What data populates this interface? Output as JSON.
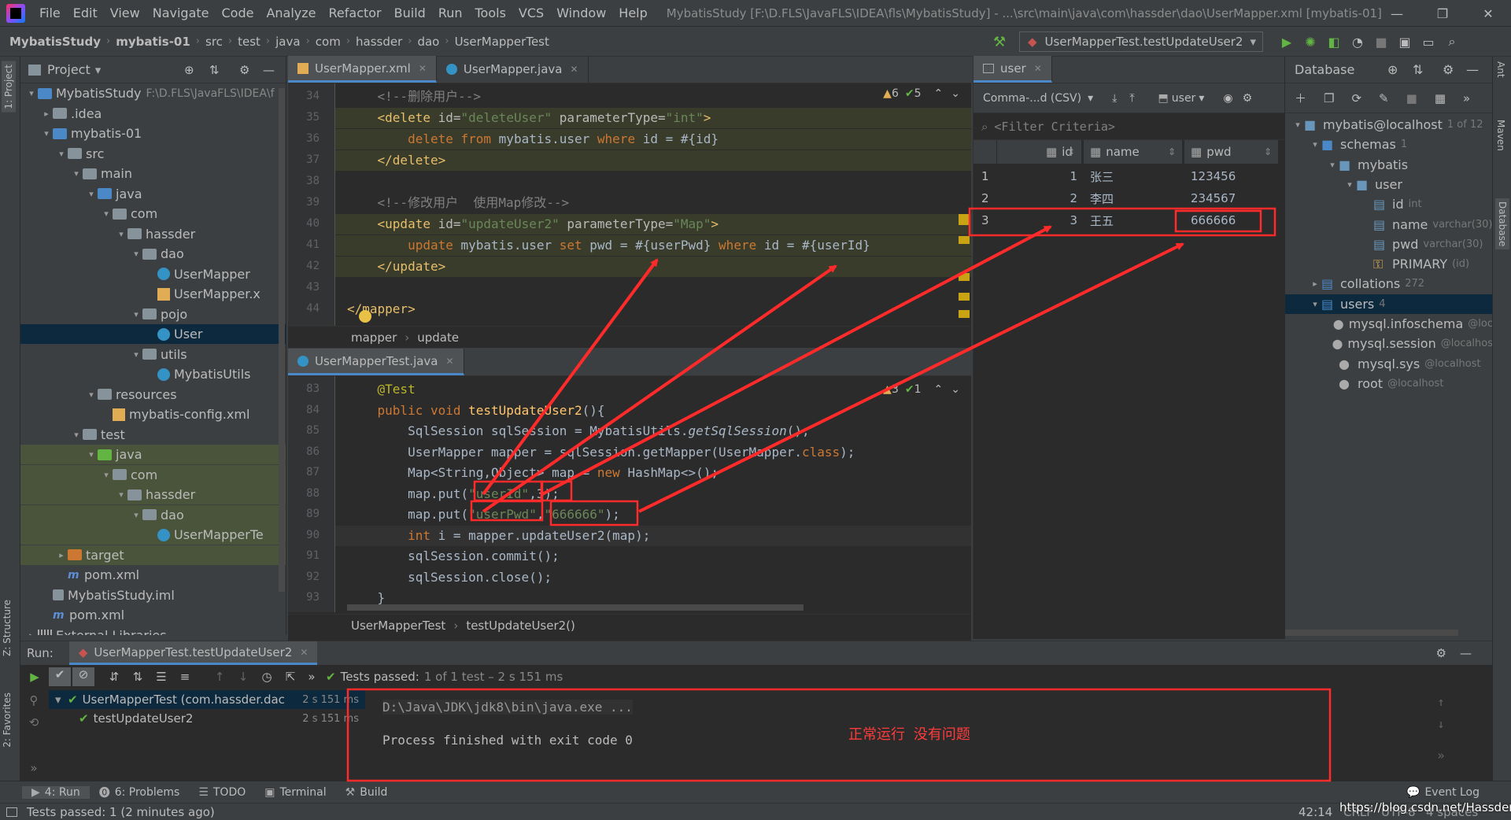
{
  "menu": {
    "items": [
      "File",
      "Edit",
      "View",
      "Navigate",
      "Code",
      "Analyze",
      "Refactor",
      "Build",
      "Run",
      "Tools",
      "VCS",
      "Window",
      "Help"
    ],
    "window_title": "MybatisStudy [F:\\D.FLS\\JavaFLS\\IDEA\\fls\\MybatisStudy] - ...\\src\\main\\java\\com\\hassder\\dao\\UserMapper.xml [mybatis-01]"
  },
  "navbar": {
    "crumbs": [
      "MybatisStudy",
      "mybatis-01",
      "src",
      "test",
      "java",
      "com",
      "hassder",
      "dao",
      "UserMapperTest"
    ],
    "run_config": "UserMapperTest.testUpdateUser2"
  },
  "left_strip": {
    "project_tab": "1: Project",
    "structure_tab": "Z: Structure",
    "favorites_tab": "2: Favorites"
  },
  "project": {
    "title": "Project",
    "tree": [
      {
        "label": "MybatisStudy",
        "extra": "F:\\D.FLS\\JavaFLS\\IDEA\\f",
        "indent": 0,
        "kind": "folder-blue",
        "open": true
      },
      {
        "label": ".idea",
        "indent": 1,
        "kind": "folder",
        "open": false
      },
      {
        "label": "mybatis-01",
        "indent": 1,
        "kind": "folder-blue",
        "open": true
      },
      {
        "label": "src",
        "indent": 2,
        "kind": "folder",
        "open": true
      },
      {
        "label": "main",
        "indent": 3,
        "kind": "folder",
        "open": true
      },
      {
        "label": "java",
        "indent": 4,
        "kind": "folder-blue",
        "open": true
      },
      {
        "label": "com",
        "indent": 5,
        "kind": "folder",
        "open": true
      },
      {
        "label": "hassder",
        "indent": 6,
        "kind": "folder",
        "open": true
      },
      {
        "label": "dao",
        "indent": 7,
        "kind": "folder",
        "open": true
      },
      {
        "label": "UserMapper",
        "indent": 8,
        "kind": "class"
      },
      {
        "label": "UserMapper.x",
        "indent": 8,
        "kind": "xml"
      },
      {
        "label": "pojo",
        "indent": 7,
        "kind": "folder",
        "open": true
      },
      {
        "label": "User",
        "indent": 8,
        "kind": "class",
        "selected": true
      },
      {
        "label": "utils",
        "indent": 7,
        "kind": "folder",
        "open": true
      },
      {
        "label": "MybatisUtils",
        "indent": 8,
        "kind": "class"
      },
      {
        "label": "resources",
        "indent": 4,
        "kind": "folder",
        "open": true
      },
      {
        "label": "mybatis-config.xml",
        "indent": 5,
        "kind": "xml"
      },
      {
        "label": "test",
        "indent": 3,
        "kind": "folder",
        "open": true
      },
      {
        "label": "java",
        "indent": 4,
        "kind": "folder-green",
        "open": true,
        "green": true
      },
      {
        "label": "com",
        "indent": 5,
        "kind": "folder",
        "open": true,
        "green": true
      },
      {
        "label": "hassder",
        "indent": 6,
        "kind": "folder",
        "open": true,
        "green": true
      },
      {
        "label": "dao",
        "indent": 7,
        "kind": "folder",
        "open": true,
        "green": true
      },
      {
        "label": "UserMapperTe",
        "indent": 8,
        "kind": "class",
        "green": true
      },
      {
        "label": "target",
        "indent": 2,
        "kind": "folder-orange",
        "open": false,
        "green": true
      },
      {
        "label": "pom.xml",
        "indent": 2,
        "kind": "maven"
      },
      {
        "label": "MybatisStudy.iml",
        "indent": 1,
        "kind": "iml"
      },
      {
        "label": "pom.xml",
        "indent": 1,
        "kind": "maven"
      },
      {
        "label": "External Libraries",
        "indent": 0,
        "kind": "lib",
        "open": false
      }
    ]
  },
  "editor_top": {
    "tabs": [
      {
        "label": "UserMapper.xml",
        "active": true
      },
      {
        "label": "UserMapper.java",
        "active": false
      }
    ],
    "status": {
      "warnings": "6",
      "ok": "5"
    },
    "lines": [
      {
        "no": "34",
        "html": "    <span class='cmt'>&lt;!--删除用户--&gt;</span>"
      },
      {
        "no": "35",
        "html": "    <span class='tag'>&lt;delete</span> <span class='attr'>id=</span><span class='str'>\"deleteUser\"</span> <span class='attr'>parameterType=</span><span class='str'>\"int\"</span><span class='tag'>&gt;</span>",
        "hl": true
      },
      {
        "no": "36",
        "html": "        <span class='sqlkw'>delete from</span> <span class='ident'>mybatis.user</span> <span class='sqlkw'>where</span> <span class='ident'>id = #{id}</span>",
        "hl": true
      },
      {
        "no": "37",
        "html": "    <span class='tag'>&lt;/delete&gt;</span>",
        "hl": true
      },
      {
        "no": "38",
        "html": ""
      },
      {
        "no": "39",
        "html": "    <span class='cmt'>&lt;!--修改用户  使用Map修改--&gt;</span>"
      },
      {
        "no": "40",
        "html": "    <span class='tag'>&lt;update</span> <span class='attr'>id=</span><span class='str'>\"updateUser2\"</span> <span class='attr'>parameterType=</span><span class='str'>\"Map\"</span><span class='tag'>&gt;</span>",
        "hl": true
      },
      {
        "no": "41",
        "html": "        <span class='sqlkw'>update</span> <span class='ident'>mybatis.user</span> <span class='sqlkw'>set</span> <span class='ident'>pwd = #{userPwd}</span> <span class='sqlkw'>where</span> <span class='ident'>id = #{userId}</span>",
        "hl": true
      },
      {
        "no": "42",
        "html": "    <span class='tag'>&lt;/update&gt;</span>",
        "hl": true
      },
      {
        "no": "43",
        "html": ""
      },
      {
        "no": "44",
        "html": "<span class='tag'>&lt;/mapper&gt;</span>"
      }
    ],
    "breadcrumb": [
      "mapper",
      "update"
    ]
  },
  "editor_bottom": {
    "tabs": [
      {
        "label": "UserMapperTest.java",
        "active": true
      }
    ],
    "status": {
      "warnings": "3",
      "ok": "1"
    },
    "lines": [
      {
        "no": "83",
        "html": "    <span class='ann'>@Test</span>"
      },
      {
        "no": "84",
        "html": "    <span class='kw'>public void</span> <span class='fn'>testUpdateUser2</span><span class='ident'>(){</span>"
      },
      {
        "no": "85",
        "html": "        <span class='ident'>SqlSession sqlSession = MybatisUtils.</span><span class='ident italic'>getSqlSession</span><span class='ident'>();</span>"
      },
      {
        "no": "86",
        "html": "        <span class='ident'>UserMapper mapper = sqlSession.getMapper(UserMapper.</span><span class='kw'>class</span><span class='ident'>);</span>"
      },
      {
        "no": "87",
        "html": "        <span class='ident'>Map&lt;String,Object&gt; map = </span><span class='kw'>new</span> <span class='ident'>HashMap&lt;&gt;();</span>"
      },
      {
        "no": "88",
        "html": "        <span class='ident'>map.put(</span><span class='str'>\"userId\"</span><span class='ident'>,</span><span class='ident'>3</span><span class='ident'>);</span>"
      },
      {
        "no": "89",
        "html": "        <span class='ident'>map.put(</span><span class='str'>\"userPwd\"</span><span class='ident'>,</span><span class='str'>\"666666\"</span><span class='ident'>);</span>"
      },
      {
        "no": "90",
        "html": "        <span class='kw'>int</span> <span class='ident'>i = mapper.updateUser2(map);</span>",
        "cur": true
      },
      {
        "no": "91",
        "html": "        <span class='ident'>sqlSession.commit();</span>"
      },
      {
        "no": "92",
        "html": "        <span class='ident'>sqlSession.close();</span>"
      },
      {
        "no": "93",
        "html": "    <span class='ident'>}</span>"
      },
      {
        "no": "94",
        "html": ""
      }
    ],
    "breadcrumb": [
      "UserMapperTest",
      "testUpdateUser2()"
    ]
  },
  "db_view": {
    "tab": "user",
    "format": "Comma-...d (CSV)",
    "schema_btn": "user",
    "filter_placeholder": "<Filter Criteria>",
    "columns": [
      "id",
      "name",
      "pwd"
    ],
    "rows": [
      {
        "n": "1",
        "id": "1",
        "name": "张三",
        "pwd": "123456"
      },
      {
        "n": "2",
        "id": "2",
        "name": "李四",
        "pwd": "234567"
      },
      {
        "n": "3",
        "id": "3",
        "name": "王五",
        "pwd": "666666"
      }
    ]
  },
  "database": {
    "title": "Database",
    "tree": [
      {
        "label": "mybatis@localhost",
        "dim": "1 of 12",
        "indent": 0
      },
      {
        "label": "schemas",
        "dim": "1",
        "indent": 1
      },
      {
        "label": "mybatis",
        "indent": 2
      },
      {
        "label": "user",
        "indent": 3
      },
      {
        "label": "id",
        "dim": "int",
        "indent": 4
      },
      {
        "label": "name",
        "dim": "varchar(30)",
        "indent": 4
      },
      {
        "label": "pwd",
        "dim": "varchar(30)",
        "indent": 4
      },
      {
        "label": "PRIMARY",
        "dim": "(id)",
        "indent": 4
      },
      {
        "label": "collations",
        "dim": "272",
        "indent": 1
      },
      {
        "label": "users",
        "dim": "4",
        "indent": 1,
        "selected": true
      },
      {
        "label": "mysql.infoschema",
        "dim": "@loc",
        "indent": 2
      },
      {
        "label": "mysql.session",
        "dim": "@localhos",
        "indent": 2
      },
      {
        "label": "mysql.sys",
        "dim": "@localhost",
        "indent": 2
      },
      {
        "label": "root",
        "dim": "@localhost",
        "indent": 2
      }
    ],
    "side_tabs": [
      "Ant",
      "Maven",
      "Database"
    ]
  },
  "run": {
    "label": "Run:",
    "config_tab": "UserMapperTest.testUpdateUser2",
    "tests_passed": "Tests passed:",
    "tests_detail": "1 of 1 test – 2 s 151 ms",
    "tree": [
      {
        "label": "UserMapperTest (com.hassder.dac",
        "time": "2 s 151 ms",
        "selected": true
      },
      {
        "label": "testUpdateUser2",
        "time": "2 s 151 ms"
      }
    ],
    "console": [
      "D:\\Java\\JDK\\jdk8\\bin\\java.exe ...",
      "Process finished with exit code 0"
    ],
    "annotation": "正常运行 没有问题"
  },
  "toolwindows": [
    {
      "label": "4: Run"
    },
    {
      "label": "6: Problems"
    },
    {
      "label": "TODO"
    },
    {
      "label": "Terminal"
    },
    {
      "label": "Build"
    }
  ],
  "event_log": "Event Log",
  "status": {
    "left": "Tests passed: 1 (2 minutes ago)",
    "pos": "42:14",
    "crlf": "CRLF",
    "enc": "UTF-8",
    "spaces": "4 spaces",
    "watermark": "https://blog.csdn.net/Hassder"
  },
  "colors": {
    "accent": "#4a88c7",
    "annotation_red": "#ff2a2a"
  }
}
